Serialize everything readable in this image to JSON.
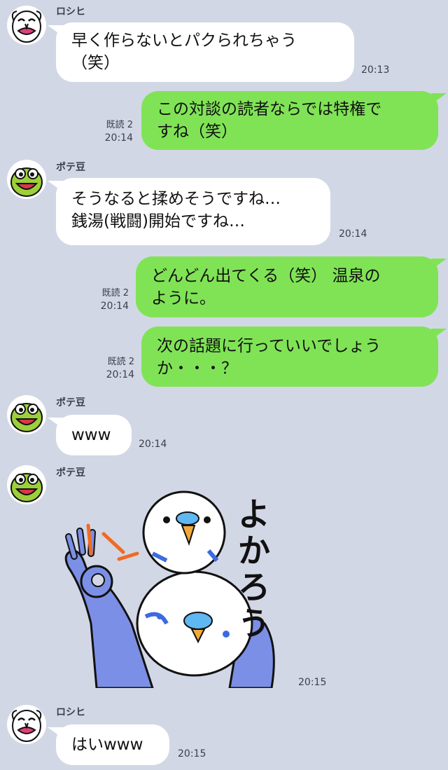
{
  "messages": [
    {
      "sender": "ロシヒ",
      "text": "早く作らないとパクられちゃう（笑）",
      "time": "20:13"
    },
    {
      "text": "この対談の読者ならでは特権ですね（笑）",
      "read": "既読 2",
      "time": "20:14"
    },
    {
      "sender": "ポテ豆",
      "text": "そうなると揉めそうですね…銭湯(戦闘)開始ですね…",
      "time": "20:14"
    },
    {
      "text": "どんどん出てくる（笑） 温泉のように。",
      "read": "既読 2",
      "time": "20:14"
    },
    {
      "text": "次の話題に行っていいでしょうか・・・？",
      "read": "既読 2",
      "time": "20:14"
    },
    {
      "sender": "ポテ豆",
      "text": "www",
      "time": "20:14"
    },
    {
      "sender": "ポテ豆",
      "sticker_text": "よかろう",
      "time": "20:15"
    },
    {
      "sender": "ロシヒ",
      "text": "はいwww",
      "time": "20:15"
    }
  ],
  "lines": {
    "m0": [
      "早く作らないとパクられちゃう",
      "（笑）"
    ],
    "m1": [
      "この対談の読者ならでは特権で",
      "すね（笑）"
    ],
    "m2": [
      "そうなると揉めそうですね…",
      "銭湯(戦闘)開始ですね…"
    ],
    "m3": [
      "どんどん出てくる（笑） 温泉の",
      "ように。"
    ],
    "m4": [
      "次の話題に行っていいでしょう",
      "か・・・？"
    ]
  },
  "colors": {
    "background": "#d2d7e5",
    "outgoing": "#80e356",
    "incoming": "#ffffff"
  }
}
